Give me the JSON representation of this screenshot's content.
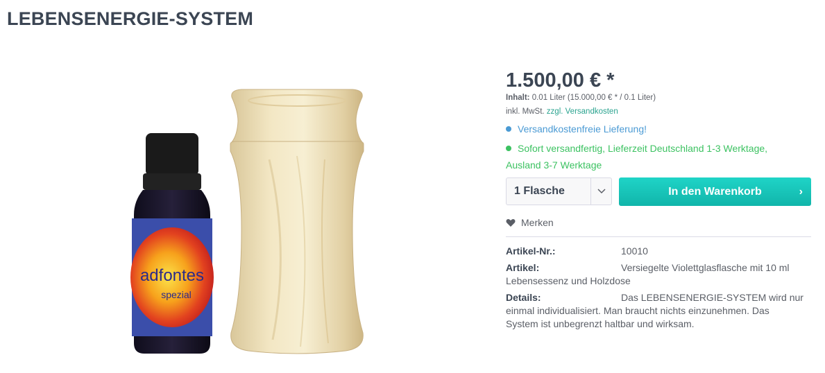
{
  "page": {
    "title": "LEBENSENERGIE-SYSTEM"
  },
  "product": {
    "price": "1.500,00 € *",
    "unit_label": "Inhalt:",
    "unit_value": "0.01 Liter (15.000,00 € * / 0.1 Liter)",
    "tax_text": "inkl. MwSt.",
    "shipping_link": "zzgl. Versandkosten",
    "delivery_free": "Versandkostenfreie Lieferung!",
    "delivery_status": "Sofort versandfertig, Lieferzeit Deutschland 1-3 Werktage, Ausland 3-7 Werktage",
    "quantity_selected": "1 Flasche",
    "add_to_cart": "In den Warenkorb",
    "wishlist": "Merken",
    "image_label": {
      "line1": "adfontes",
      "line2": "spezial"
    }
  },
  "details": [
    {
      "label": "Artikel-Nr.:",
      "value": "10010"
    },
    {
      "label": "Artikel:",
      "value": "Versiegelte Violettglasflasche mit 10 ml Lebensessenz und Holzdose"
    },
    {
      "label": "Details:",
      "value": "Das LEBENSENERGIE-SYSTEM wird nur einmal individualisiert. Man braucht nichts einzunehmen. Das System ist unbegrenzt haltbar und wirksam."
    }
  ],
  "colors": {
    "accent": "#14c0b4",
    "link": "#2aa38f",
    "info": "#4a9ad4",
    "success": "#3cc261",
    "title": "#3b4553"
  }
}
